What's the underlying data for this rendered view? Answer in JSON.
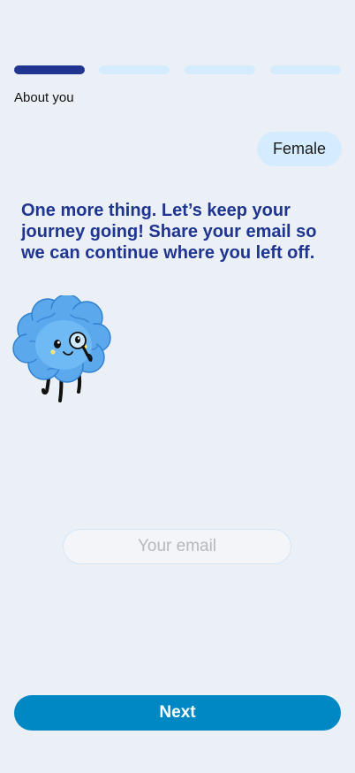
{
  "progress": {
    "step_label": "About you",
    "total_steps": 4,
    "current_step": 1,
    "active_color": "#1f3590",
    "inactive_color": "#d4ecfd"
  },
  "chat": {
    "user_answer": "Female",
    "prompt": "One more thing. Let’s keep your journey going! Share your email so we can continue where you left off."
  },
  "mascot": {
    "icon": "brain-mascot-with-magnifier-icon"
  },
  "email_field": {
    "value": "",
    "placeholder": "Your email"
  },
  "next_button": {
    "label": "Next",
    "color": "#0088c4"
  }
}
